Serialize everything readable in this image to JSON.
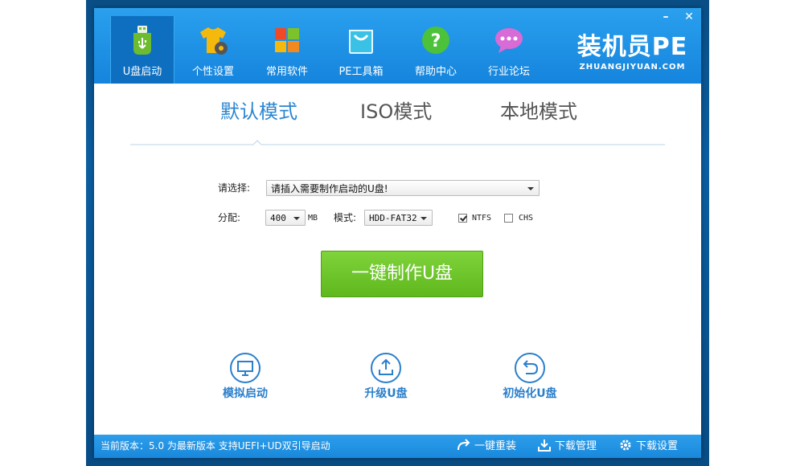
{
  "app": {
    "brand_title": "装机员PE",
    "brand_subtitle": "ZHUANGJIYUAN.COM"
  },
  "window_controls": {
    "minimize": "–",
    "close": "✕"
  },
  "nav": [
    {
      "label": "U盘启动",
      "icon": "usb-drive-icon",
      "active": true
    },
    {
      "label": "个性设置",
      "icon": "tshirt-gear-icon"
    },
    {
      "label": "常用软件",
      "icon": "windows-tiles-icon"
    },
    {
      "label": "PE工具箱",
      "icon": "shopping-bag-icon"
    },
    {
      "label": "帮助中心",
      "icon": "help-icon"
    },
    {
      "label": "行业论坛",
      "icon": "chat-bubble-icon"
    }
  ],
  "mode_tabs": [
    {
      "label": "默认模式",
      "active": true
    },
    {
      "label": "ISO模式"
    },
    {
      "label": "本地模式"
    }
  ],
  "form": {
    "select_label": "请选择:",
    "select_value": "请插入需要制作启动的U盘!",
    "partition_label": "分配:",
    "partition_value": "400",
    "partition_unit": "MB",
    "mode_label": "模式:",
    "mode_value": "HDD-FAT32",
    "ntfs_label": "NTFS",
    "ntfs_checked": true,
    "chs_label": "CHS",
    "chs_checked": false
  },
  "make_button": "一键制作U盘",
  "tools": [
    {
      "label": "模拟启动",
      "icon": "monitor-icon"
    },
    {
      "label": "升级U盘",
      "icon": "upload-icon"
    },
    {
      "label": "初始化U盘",
      "icon": "undo-icon"
    }
  ],
  "status": {
    "version_text": "当前版本：5.0 为最新版本 支持UEFI+UD双引导启动",
    "reinstall": "一键重装",
    "download_manager": "下载管理",
    "download_settings": "下载设置"
  },
  "colors": {
    "header_blue": "#1f93e6",
    "accent_blue": "#2b86d1",
    "button_green": "#6cc52a"
  }
}
